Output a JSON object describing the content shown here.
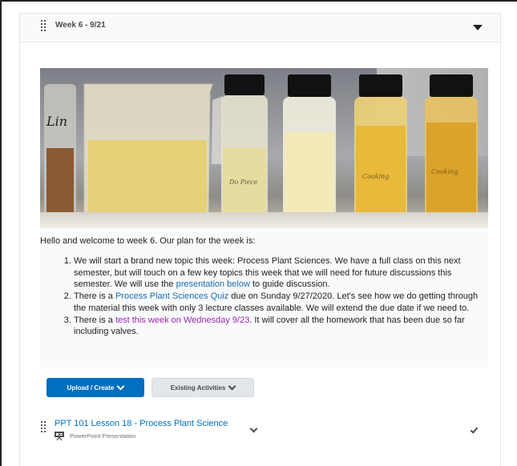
{
  "module": {
    "title": "Week 6 - 9/21"
  },
  "content": {
    "hero_image_alt": "Laboratory glassware and bottles of plant oils",
    "bottle_labels": [
      "Lin",
      "Do Piece",
      "Cooking",
      "Cooking"
    ],
    "intro": "Hello and welcome to week 6. Our plan for the week is:",
    "items": [
      {
        "before": "We will start a brand new topic this week: Process Plant Sciences. We have a full class on this next semester, but will touch on a few key topics this week that we will need for future discussions this semester. We will use the ",
        "link": "presentation below",
        "after": " to guide discussion."
      },
      {
        "before": "There is a ",
        "link": "Process Plant Sciences Quiz",
        "after": " due on Sunday 9/27/2020. Let's see how we do getting through the material this week with only 3 lecture classes available. We will extend the due date if we need to."
      },
      {
        "before": "There is a ",
        "link": "test this week on Wednesday 9/23",
        "after": ". It will cover all the homework that has been due so far including valves."
      }
    ]
  },
  "buttons": {
    "upload_create": "Upload / Create",
    "existing_activities": "Existing Activities"
  },
  "activity": {
    "title": "PPT 101 Lesson 18 - Process Plant Science",
    "type": "PowerPoint Presentation"
  },
  "colors": {
    "primary": "#006fbf",
    "link": "#1a6daf",
    "visited_link": "#9c27b0"
  }
}
